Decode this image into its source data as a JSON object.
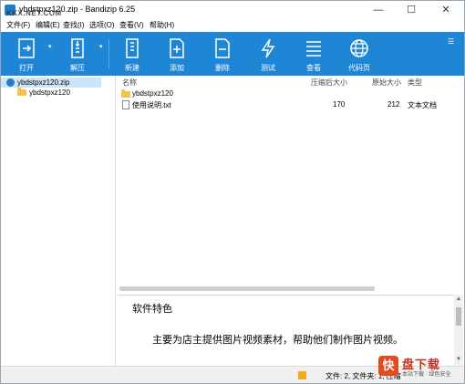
{
  "window": {
    "title": "ybdstpxz120.zip - Bandizip 6.25",
    "watermark": "KKX.NET.COM",
    "controls": {
      "minimize": "—",
      "maximize": "☐",
      "close": "✕"
    }
  },
  "menu": [
    "文件(F)",
    "编辑(E)",
    "查找(I)",
    "选项(O)",
    "查看(V)",
    "帮助(H)"
  ],
  "toolbar": {
    "open": "打开",
    "extract": "解压",
    "new": "新建",
    "add": "添加",
    "delete": "删除",
    "test": "测试",
    "view": "查看",
    "codepage": "代码页",
    "dropdown": "▾",
    "overflow": "☰"
  },
  "tree": {
    "root": "ybdstpxz120.zip",
    "child": "ybdstpxz120"
  },
  "filelist": {
    "columns": {
      "name": "名称",
      "compressed": "压缩后大小",
      "original": "原始大小",
      "type": "类型"
    },
    "rows": [
      {
        "name": "ybdstpxz120",
        "compressed": "",
        "original": "",
        "type": ""
      },
      {
        "name": "使用说明.txt",
        "compressed": "170",
        "original": "212",
        "type": "文本文档"
      }
    ]
  },
  "info": {
    "title": "软件特色",
    "description": "主要为店主提供图片视频素材，帮助他们制作图片视频。"
  },
  "status": {
    "text": "文件: 2, 文件夹: 1, 压缩"
  },
  "logo": {
    "mark": "快",
    "main": "盘下载",
    "sub": "本站下载 · 绿色安全"
  },
  "colors": {
    "toolbar": "#1f86d6",
    "selection": "#cce4f7",
    "folder": "#f2c14e"
  }
}
